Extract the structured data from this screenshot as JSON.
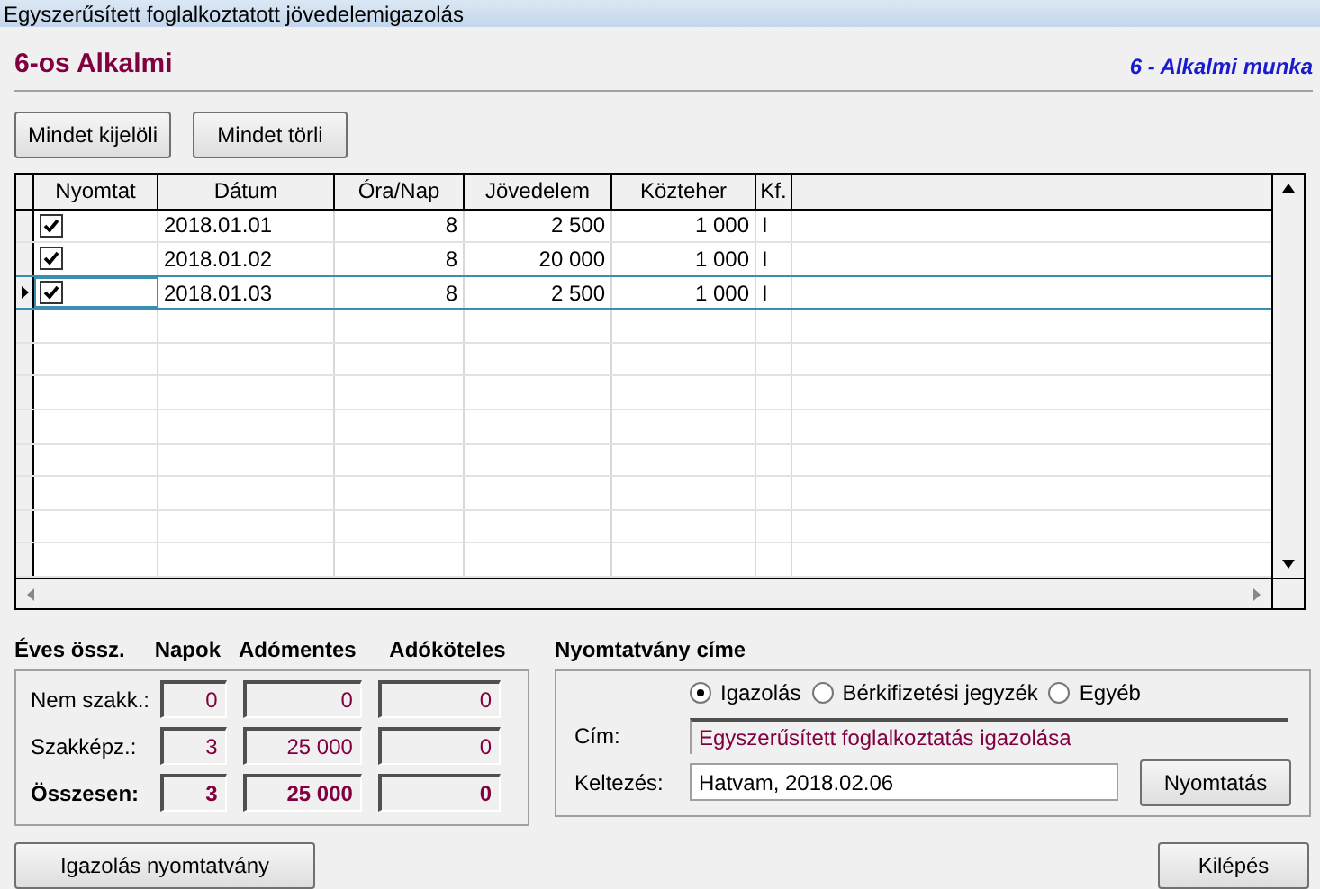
{
  "window": {
    "title": "Egyszerűsített foglalkoztatott jövedelemigazolás"
  },
  "header": {
    "title": "6-os Alkalmi",
    "subtitle": "6 - Alkalmi munka"
  },
  "top_buttons": [
    "Mindet kijelöli",
    "Mindet törli"
  ],
  "table": {
    "columns": [
      "Nyomtat",
      "Dátum",
      "Óra/Nap",
      "Jövedelem",
      "Közteher",
      "Kf."
    ],
    "rows": [
      {
        "selected": false,
        "cells": [
          {
            "kind": "checkbox",
            "checked": true
          },
          "2018.01.01",
          "8",
          "2 500",
          "1 000",
          "I"
        ]
      },
      {
        "selected": false,
        "cells": [
          {
            "kind": "checkbox",
            "checked": true
          },
          "2018.01.02",
          "8",
          "20 000",
          "1 000",
          "I"
        ]
      },
      {
        "selected": true,
        "cells": [
          {
            "kind": "checkbox",
            "checked": true
          },
          "2018.01.03",
          "8",
          "2 500",
          "1 000",
          "I"
        ]
      }
    ]
  },
  "summary": {
    "columns": [
      "Éves össz.",
      "Napok",
      "Adómentes",
      "Adóköteles"
    ],
    "rows": [
      {
        "label": "Nem szakk.:",
        "total": false,
        "values": [
          "0",
          "0",
          "0"
        ]
      },
      {
        "label": "Szakképz.:",
        "total": false,
        "values": [
          "3",
          "25 000",
          "0"
        ]
      },
      {
        "label": "Összesen:",
        "total": true,
        "values": [
          "3",
          "25 000",
          "0"
        ]
      }
    ]
  },
  "print_form": {
    "title": "Nyomtatvány címe",
    "options": [
      {
        "label": "Igazolás",
        "selected": true
      },
      {
        "label": "Bérkifizetési jegyzék",
        "selected": false
      },
      {
        "label": "Egyéb",
        "selected": false
      }
    ],
    "cim_label": "Cím:",
    "cim_value": "Egyszerűsített foglalkoztatás igazolása",
    "date_label": "Keltezés:",
    "date_value": "Hatvam, 2018.02.06",
    "print_button": "Nyomtatás"
  },
  "bottom_buttons": [
    "Igazolás nyomtatvány",
    "Kilépés"
  ]
}
